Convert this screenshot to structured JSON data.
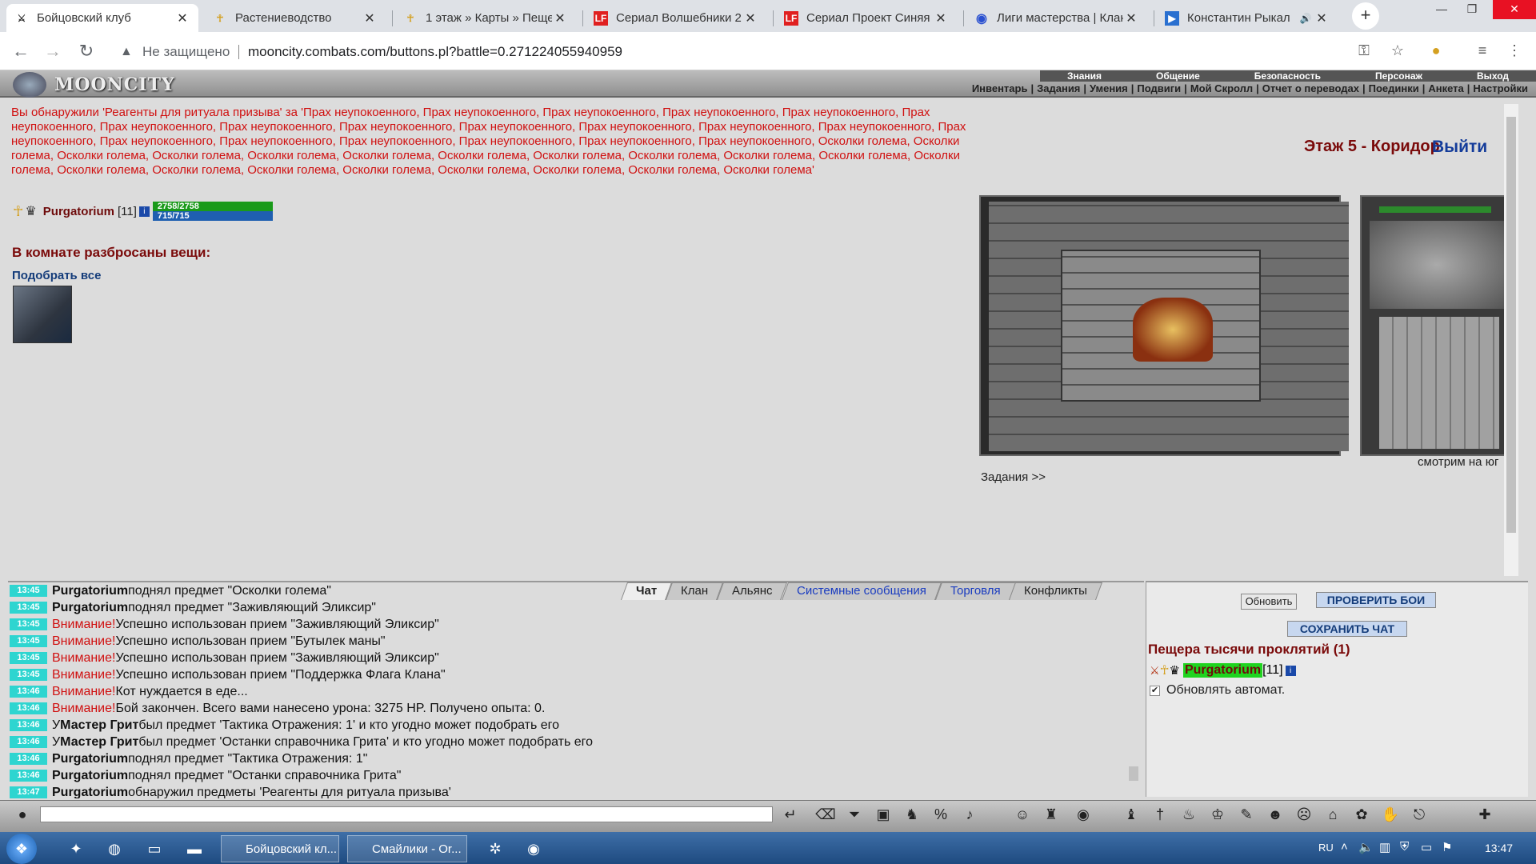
{
  "browser": {
    "tabs": [
      {
        "title": "Бойцовский клуб",
        "icon": "crossed-swords-icon",
        "active": true
      },
      {
        "title": "Растениеводство",
        "icon": "ankh-icon"
      },
      {
        "title": "1 этаж » Карты » Пещера",
        "icon": "ankh-icon"
      },
      {
        "title": "Сериал Волшебники 2",
        "icon": "lf-icon"
      },
      {
        "title": "Сериал Проект Синяя",
        "icon": "lf-icon"
      },
      {
        "title": "Лиги мастерства | Клан",
        "icon": "discord-icon"
      },
      {
        "title": "Константин Рыкал",
        "icon": "video-icon"
      }
    ],
    "address": {
      "security": "Не защищено",
      "url": "mooncity.combats.com/buttons.pl?battle=0.271224055940959"
    }
  },
  "game": {
    "logo": "MOONCITY",
    "main_menu": [
      "Знания",
      "Общение",
      "Безопасность",
      "Персонаж",
      "Выход"
    ],
    "sub_menu": [
      "Инвентарь",
      "Задания",
      "Умения",
      "Подвиги",
      "Мой Скролл",
      "Отчет о переводах",
      "Поединки",
      "Анкета",
      "Настройки"
    ],
    "alert": "Вы обнаружили 'Реагенты для ритуала призыва' за 'Прах неупокоенного, Прах неупокоенного, Прах неупокоенного, Прах неупокоенного, Прах неупокоенного, Прах неупокоенного, Прах неупокоенного, Прах неупокоенного, Прах неупокоенного, Прах неупокоенного, Прах неупокоенного, Прах неупокоенного, Прах неупокоенного, Прах неупокоенного, Прах неупокоенного, Прах неупокоенного, Прах неупокоенного, Прах неупокоенного, Прах неупокоенного, Прах неупокоенного, Осколки голема, Осколки голема, Осколки голема, Осколки голема, Осколки голема, Осколки голема, Осколки голема, Осколки голема, Осколки голема, Осколки голема, Осколки голема, Осколки голема, Осколки голема, Осколки голема, Осколки голема, Осколки голема, Осколки голема, Осколки голема, Осколки голема, Осколки голема'",
    "character": {
      "name": "Purgatorium",
      "level": "[11]",
      "hp": "2758/2758",
      "mana": "715/715"
    },
    "room_items_title": "В комнате разбросаны вещи:",
    "pick_all": "Подобрать все",
    "location": "Этаж 5 - Коридор",
    "exit": "Выйти",
    "look_direction": "смотрим на юг",
    "tasks_link": "Задания >>"
  },
  "chat": {
    "tabs": [
      {
        "label": "Чат",
        "style": "active"
      },
      {
        "label": "Клан",
        "style": "normal"
      },
      {
        "label": "Альянс",
        "style": "normal"
      },
      {
        "label": "Системные сообщения",
        "style": "blue"
      },
      {
        "label": "Торговля",
        "style": "blue"
      },
      {
        "label": "Конфликты",
        "style": "normal"
      }
    ],
    "lines": [
      {
        "time": "13:45",
        "name": "Purgatorium",
        "warn": "",
        "text": " поднял предмет \"Осколки голема\""
      },
      {
        "time": "13:45",
        "name": "Purgatorium",
        "warn": "",
        "text": " поднял предмет \"Заживляющий Эликсир\""
      },
      {
        "time": "13:45",
        "name": "",
        "warn": "Внимание!",
        "text": " Успешно использован прием \"Заживляющий Эликсир\""
      },
      {
        "time": "13:45",
        "name": "",
        "warn": "Внимание!",
        "text": " Успешно использован прием \"Бутылек маны\""
      },
      {
        "time": "13:45",
        "name": "",
        "warn": "Внимание!",
        "text": " Успешно использован прием \"Заживляющий Эликсир\""
      },
      {
        "time": "13:45",
        "name": "",
        "warn": "Внимание!",
        "text": " Успешно использован прием \"Поддержка Флага Клана\""
      },
      {
        "time": "13:46",
        "name": "",
        "warn": "Внимание!",
        "text": " Кот нуждается в еде..."
      },
      {
        "time": "13:46",
        "name": "",
        "warn": "Внимание!",
        "text": " Бой закончен. Всего вами нанесено урона: 3275 HP. Получено опыта: 0."
      },
      {
        "time": "13:46",
        "name": "Мастер Грит",
        "warn": "",
        "prefix": "У ",
        "text": " был предмет 'Тактика Отражения: 1' и кто угодно может подобрать его"
      },
      {
        "time": "13:46",
        "name": "Мастер Грит",
        "warn": "",
        "prefix": "У ",
        "text": " был предмет 'Останки справочника Грита' и кто угодно может подобрать его"
      },
      {
        "time": "13:46",
        "name": "Purgatorium",
        "warn": "",
        "text": " поднял предмет \"Тактика Отражения: 1\""
      },
      {
        "time": "13:46",
        "name": "Purgatorium",
        "warn": "",
        "text": " поднял предмет \"Останки справочника Грита\""
      },
      {
        "time": "13:47",
        "name": "Purgatorium",
        "warn": "",
        "text": " обнаружил предметы 'Реагенты для ритуала призыва'"
      }
    ]
  },
  "right_panel": {
    "refresh": "Обновить",
    "check_fights": "ПРОВЕРИТЬ БОИ",
    "save_chat": "СОХРАНИТЬ ЧАТ",
    "cave": "Пещера тысячи проклятий (1)",
    "player": "Purgatorium",
    "player_level": "[11]",
    "auto_refresh": "Обновлять автомат."
  },
  "taskbar": {
    "apps": [
      "Бойцовский кл...",
      "Смайлики - Or..."
    ],
    "lang": "RU",
    "time": "13:47"
  }
}
